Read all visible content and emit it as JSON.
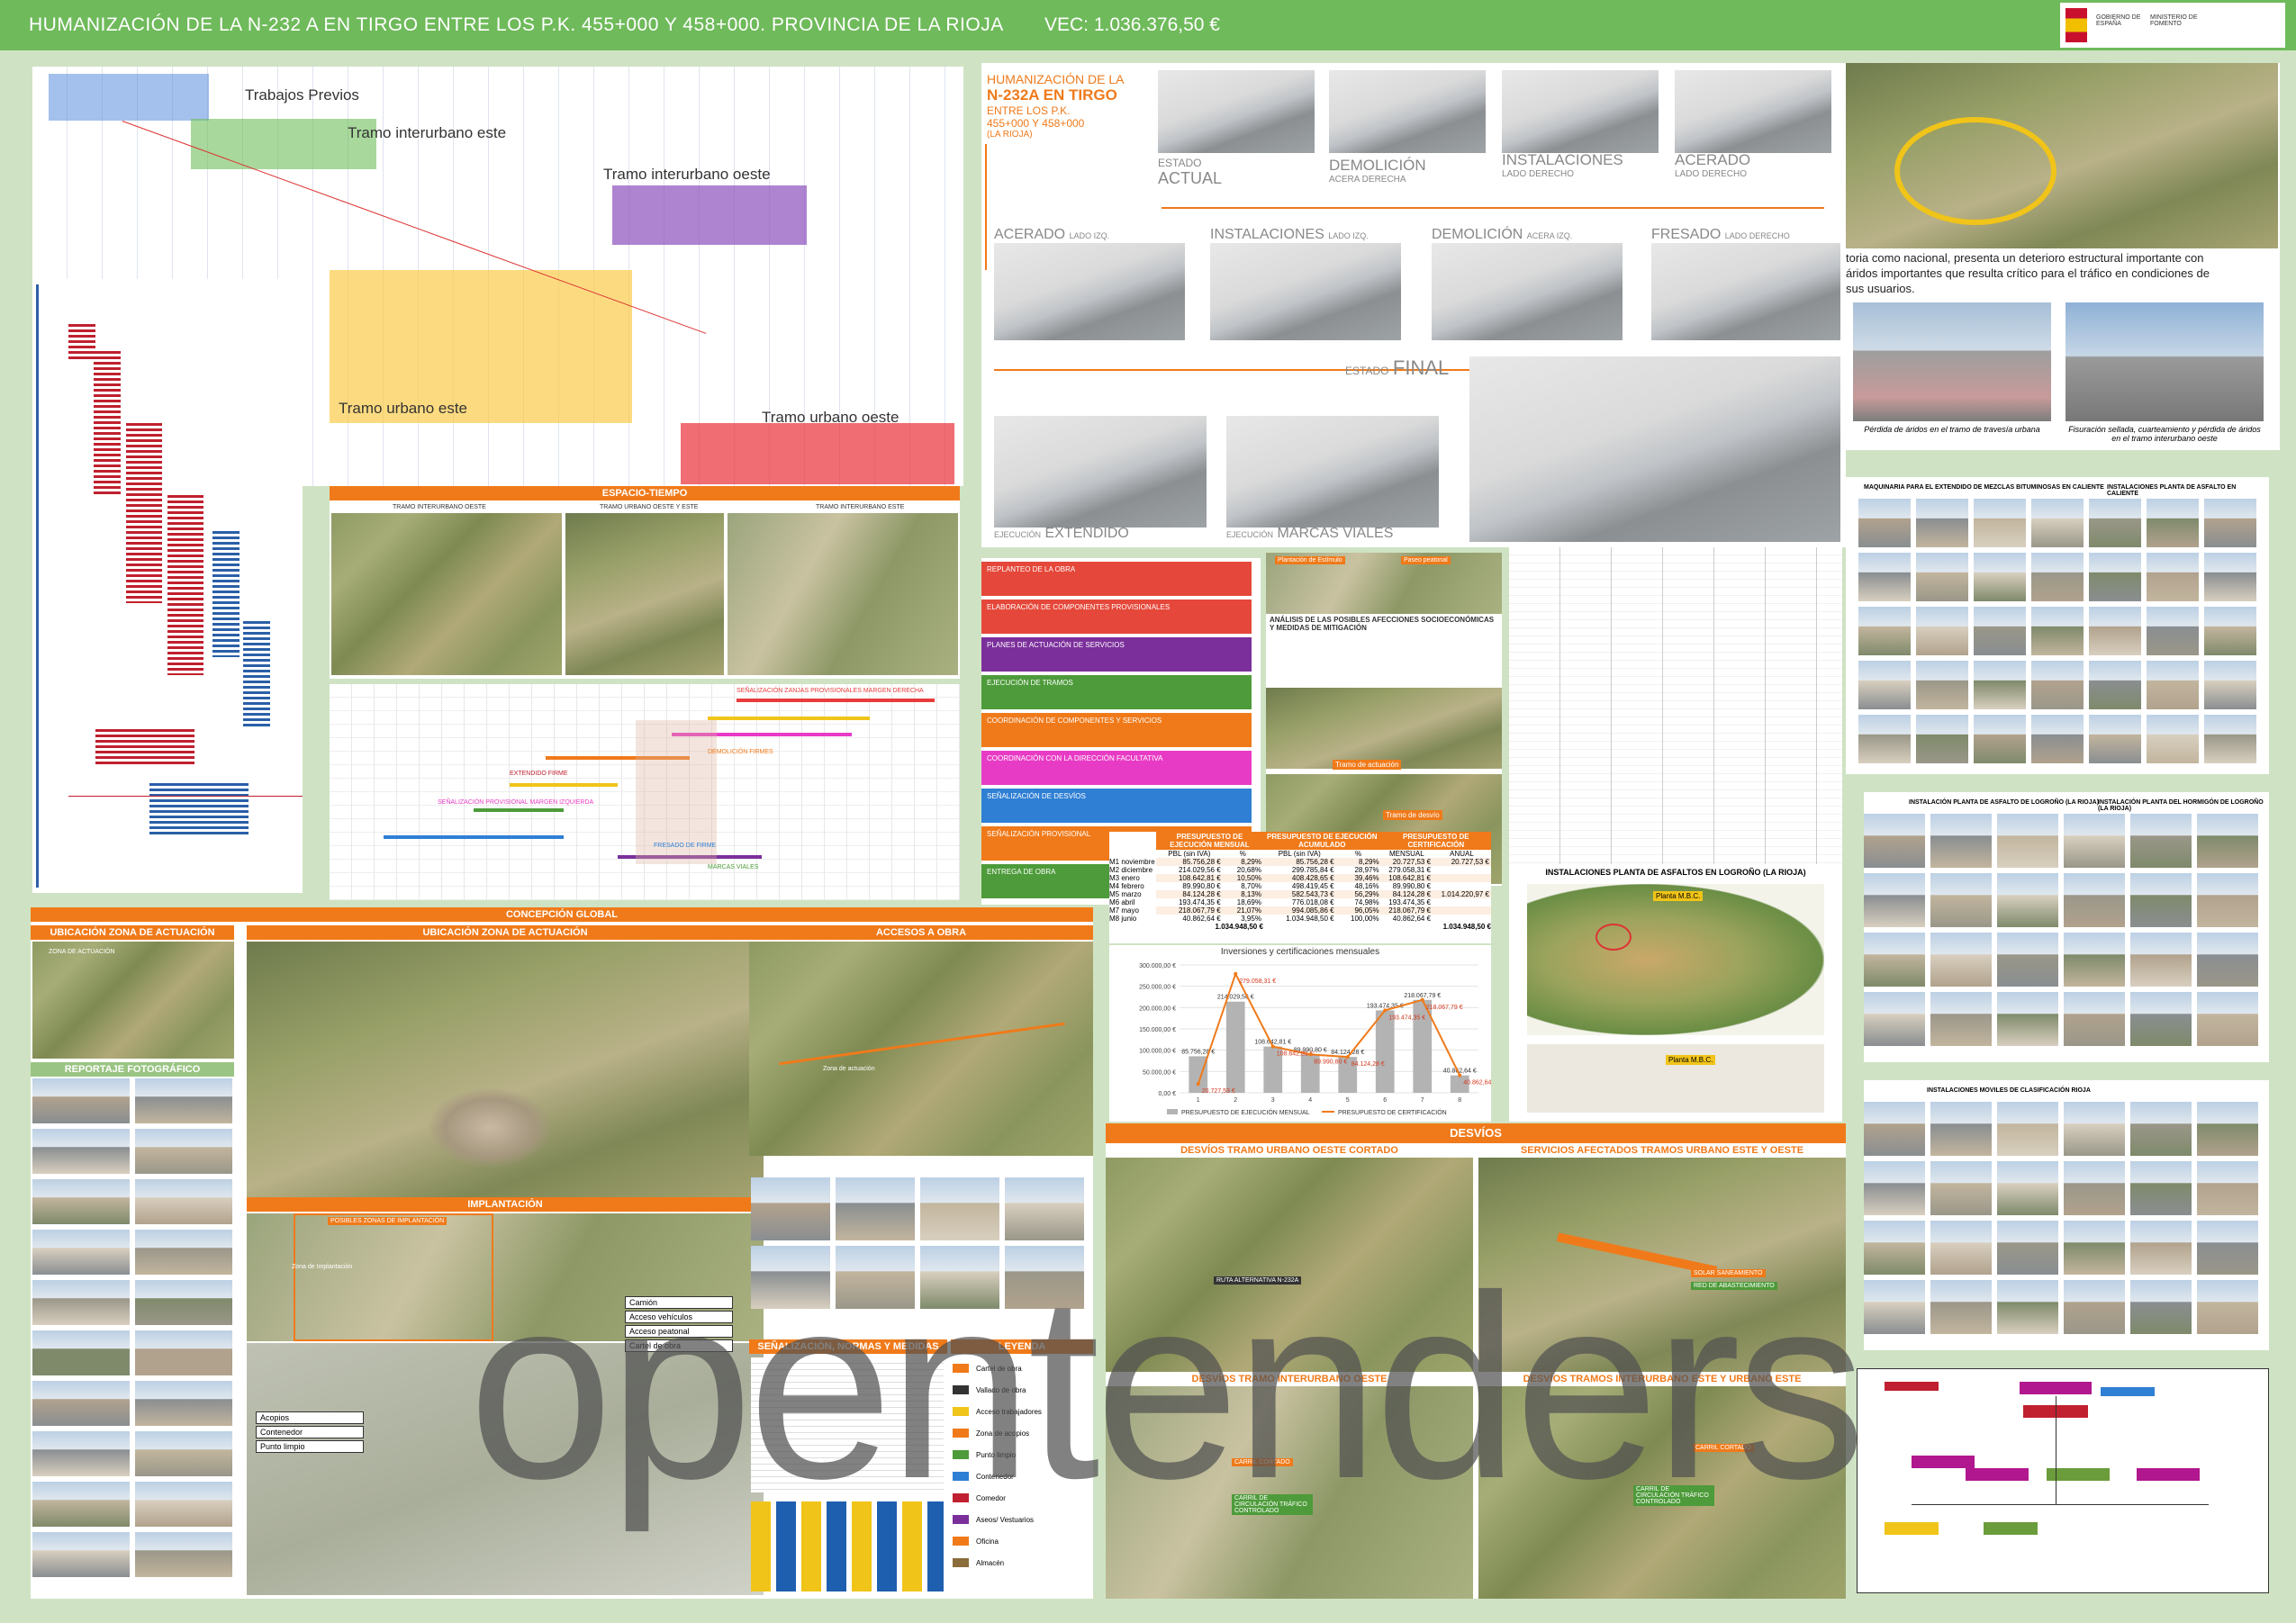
{
  "header": {
    "title": "HUMANIZACIÓN DE LA N-232 A EN TIRGO ENTRE LOS P.K. 455+000 Y 458+000. PROVINCIA DE LA RIOJA",
    "vec": "VEC: 1.036.376,50 €",
    "logo": {
      "line1": "GOBIERNO DE ESPAÑA",
      "line2": "MINISTERIO DE FOMENTO"
    },
    "colors": {
      "bar": "#6fba5b",
      "accent": "#f07a1a"
    }
  },
  "gantt": {
    "labels": [
      "Trabajos Previos",
      "Tramo interurbano este",
      "Tramo interurbano oeste",
      "Tramo urbano este",
      "Tramo urbano oeste"
    ]
  },
  "espacio_tiempo": {
    "title": "ESPACIO-TIEMPO",
    "cols": [
      "TRAMO INTERURBANO OESTE",
      "TRAMO URBANO OESTE Y ESTE",
      "TRAMO INTERURBANO ESTE"
    ]
  },
  "timeline_rows": [
    "SEÑALIZACIÓN ZANJAS PROVISIONALES MARGEN DERECHA",
    "DEMOLICIÓN FIRMES",
    "SEÑALIZACIÓN PROVISIONAL MARGEN IZQUIERDA",
    "FRESADO DE FIRME",
    "EXTENDIDO FIRME",
    "MARCAS VIALES"
  ],
  "renders": {
    "intro": {
      "l1": "HUMANIZACIÓN DE LA",
      "l2": "N-232A EN TIRGO",
      "l3": "ENTRE LOS P.K.",
      "l4": "455+000 Y 458+000",
      "l5": "(LA RIOJA)"
    },
    "row1": [
      {
        "pre": "ESTADO",
        "main": "ACTUAL",
        "sub": ""
      },
      {
        "pre": "",
        "main": "DEMOLICIÓN",
        "sub": "ACERA DERECHA"
      },
      {
        "pre": "",
        "main": "INSTALACIONES",
        "sub": "LADO DERECHO"
      },
      {
        "pre": "",
        "main": "ACERADO",
        "sub": "LADO DERECHO"
      }
    ],
    "row2": [
      {
        "main": "ACERADO",
        "sub": "LADO IZQ."
      },
      {
        "main": "INSTALACIONES",
        "sub": "LADO IZQ."
      },
      {
        "main": "DEMOLICIÓN",
        "sub": "ACERA IZQ."
      },
      {
        "main": "FRESADO",
        "sub": "LADO DERECHO"
      }
    ],
    "final": {
      "pre": "ESTADO",
      "main": "FINAL"
    },
    "row3": [
      {
        "pre": "EJECUCIÓN",
        "main": "EXTENDIDO"
      },
      {
        "pre": "EJECUCIÓN",
        "main": "MARCAS VIALES"
      }
    ]
  },
  "intro_text": {
    "line1": "toria como nacional, presenta un deterioro estructural importante con",
    "line2": "áridos importantes que resulta crítico para el tráfico en condiciones de",
    "line3": "sus usuarios.",
    "photo1": "Pérdida de áridos en el tramo de travesía urbana",
    "photo2": "Fisuración sellada, cuarteamiento y pérdida de áridos en el tramo interurbano oeste"
  },
  "process_steps": [
    {
      "t": "REPLANTEO DE LA OBRA",
      "c": "#e5483a"
    },
    {
      "t": "ELABORACIÓN DE COMPONENTES PROVISIONALES",
      "c": "#e5483a"
    },
    {
      "t": "PLANES DE ACTUACIÓN DE SERVICIOS",
      "c": "#7b2f9b"
    },
    {
      "t": "EJECUCIÓN DE TRAMOS",
      "c": "#4d9b3a"
    },
    {
      "t": "COORDINACIÓN DE COMPONENTES Y SERVICIOS",
      "c": "#f07a1a"
    },
    {
      "t": "COORDINACIÓN CON LA DIRECCIÓN FACULTATIVA",
      "c": "#e83bc5"
    },
    {
      "t": "SEÑALIZACIÓN DE DESVÍOS",
      "c": "#2f7fd4"
    },
    {
      "t": "SEÑALIZACIÓN PROVISIONAL",
      "c": "#f07a1a"
    },
    {
      "t": "ENTREGA DE OBRA",
      "c": "#4d9b3a"
    }
  ],
  "afecciones": {
    "title": "ANÁLISIS DE LAS POSIBLES AFECCIONES SOCIOECONÓMICAS Y MEDIDAS DE MITIGACIÓN",
    "a": "Plantación de Estímulo",
    "b": "Paseo peatonal",
    "c": "Tramo de actuación",
    "d": "Tramo de desvío"
  },
  "presupuesto": {
    "headers": [
      "PRESUPUESTO DE EJECUCIÓN MENSUAL",
      "PRESUPUESTO DE EJECUCIÓN ACUMULADO",
      "PRESUPUESTO DE CERTIFICACIÓN"
    ],
    "sub": [
      "PBL (sin IVA)",
      "%",
      "PBL (sin IVA)",
      "%",
      "MENSUAL",
      "ANUAL"
    ],
    "years": [
      "2023",
      "2024"
    ],
    "rows": [
      [
        "M1",
        "noviembre",
        "85.756,28 €",
        "8,29%",
        "85.756,28 €",
        "8,29%",
        "20.727,53 €",
        "20.727,53 €"
      ],
      [
        "M2",
        "diciembre",
        "214.029,56 €",
        "20,68%",
        "299.785,84 €",
        "28,97%",
        "279.058,31 €",
        ""
      ],
      [
        "M3",
        "enero",
        "108.642,81 €",
        "10,50%",
        "408.428,65 €",
        "39,46%",
        "108.642,81 €",
        ""
      ],
      [
        "M4",
        "febrero",
        "89.990,80 €",
        "8,70%",
        "498.419,45 €",
        "48,16%",
        "89.990,80 €",
        ""
      ],
      [
        "M5",
        "marzo",
        "84.124,28 €",
        "8,13%",
        "582.543,73 €",
        "56,29%",
        "84.124,28 €",
        "1.014.220,97 €"
      ],
      [
        "M6",
        "abril",
        "193.474,35 €",
        "18,69%",
        "776.018,08 €",
        "74,98%",
        "193.474,35 €",
        ""
      ],
      [
        "M7",
        "mayo",
        "218.067,79 €",
        "21,07%",
        "994.085,86 €",
        "96,05%",
        "218.067,79 €",
        ""
      ],
      [
        "M8",
        "junio",
        "40.862,64 €",
        "3,95%",
        "1.034.948,50 €",
        "100,00%",
        "40.862,64 €",
        ""
      ]
    ],
    "totals": [
      "1.034.948,50 €",
      "1.034.948,50 €"
    ]
  },
  "chart_data": {
    "type": "bar",
    "title": "Inversiones y certificaciones mensuales",
    "categories": [
      "1",
      "2",
      "3",
      "4",
      "5",
      "6",
      "7",
      "8"
    ],
    "yticks": [
      "0,00 €",
      "50.000,00 €",
      "100.000,00 €",
      "150.000,00 €",
      "200.000,00 €",
      "250.000,00 €",
      "300.000,00 €"
    ],
    "ylim": [
      0,
      300000
    ],
    "series": [
      {
        "name": "PRESUPUESTO DE EJECUCIÓN MENSUAL",
        "values": [
          85756.28,
          214029.56,
          108642.81,
          89990.8,
          84124.28,
          193474.35,
          218067.79,
          40862.64
        ],
        "color": "#b3b3b3"
      },
      {
        "name": "PRESUPUESTO DE CERTIFICACIÓN",
        "values": [
          20727.53,
          279058.31,
          108642.81,
          89990.8,
          84124.28,
          193474.35,
          218067.79,
          40862.64
        ],
        "color": "#f07a1a"
      }
    ],
    "bar_labels": [
      "85.756,28 €",
      "214.029,56 €",
      "108.642,81 €",
      "89.990,80 €",
      "84.124,28 €",
      "193.474,35 €",
      "218.067,79 €",
      "40.862,64 €"
    ],
    "line_labels": [
      "20.727,53 €",
      "279.058,31 €",
      "108.642,81 €",
      "89.990,80 €",
      "84.124,28 €",
      "193.474,35 €",
      "218.067,79 €",
      "40.862,64 €"
    ],
    "legend": "bottom"
  },
  "planta": {
    "title": "INSTALACIONES PLANTA DE ASFALTOS EN LOGROÑO (LA RIOJA)",
    "label": "Planta M.B.C."
  },
  "concepcion": {
    "title": "CONCEPCIÓN GLOBAL",
    "ubic_small": "UBICACIÓN ZONA DE ACTUACIÓN",
    "zona": "ZONA DE ACTUACIÓN",
    "reportaje": "REPORTAJE FOTOGRÁFICO",
    "ubic_big": "UBICACIÓN ZONA DE ACTUACIÓN",
    "implantacion": "IMPLANTACIÓN",
    "posibles": "POSIBLES ZONAS DE IMPLANTACIÓN",
    "zona_impl": "Zona de Implantación",
    "accesos": "ACCESOS A OBRA",
    "zona_act": "Zona de actuación",
    "legend_items": [
      "Camión",
      "Acceso vehículos",
      "Acceso peatonal",
      "Cartel de obra"
    ],
    "legend_items2": [
      "Acopios",
      "Contenedor",
      "Punto limpio"
    ],
    "senal": "SEÑALIZACIÓN, NORMAS Y MEDIDAS PREVENTIVAS",
    "leyenda": "LEYENDA",
    "leyenda_items": [
      "Cartel de obra",
      "Vallado de obra",
      "Acceso trabajadores",
      "Zona de acopios",
      "Punto limpio",
      "Contenedor",
      "Comedor",
      "Aseos/ Vestuarios",
      "Oficina",
      "Almacén"
    ]
  },
  "desvios": {
    "title": "DESVÍOS",
    "q": [
      "DESVÍOS TRAMO URBANO OESTE CORTADO",
      "SERVICIOS AFECTADOS TRAMOS URBANO ESTE Y OESTE",
      "DESVÍOS TRAMO INTERURBANO OESTE",
      "DESVÍOS TRAMOS INTERURBANO ESTE Y URBANO ESTE"
    ],
    "ruta": "RUTA ALTERNATIVA N-232A",
    "carril_a": "CARRIL CORTADO",
    "carril_b": "CARRIL DE CIRCULACIÓN TRÁFICO CONTROLADO",
    "carril_c": "CARRIL DE CIRCULACIÓN TRÁFICO CONTROLADO",
    "sat": "SOLAR SANEAMIENTO",
    "red": "RED DE ABASTECIMIENTO"
  },
  "maquinaria": {
    "t1": "MAQUINARIA PARA EL EXTENDIDO DE MEZCLAS BITUMINOSAS EN CALIENTE",
    "t2": "INSTALACIONES PLANTA DE ASFALTO EN CALIENTE",
    "t3": "INSTALACIÓN PLANTA DE ASFALTO DE LOGROÑO (LA RIOJA)",
    "t4": "INSTALACIÓN PLANTA DEL HORMIGÓN DE LOGROÑO (LA RIOJA)",
    "t5": "INSTALACIONES MOVILES DE CLASIFICACIÓN RIOJA"
  },
  "watermark": "opentenders"
}
